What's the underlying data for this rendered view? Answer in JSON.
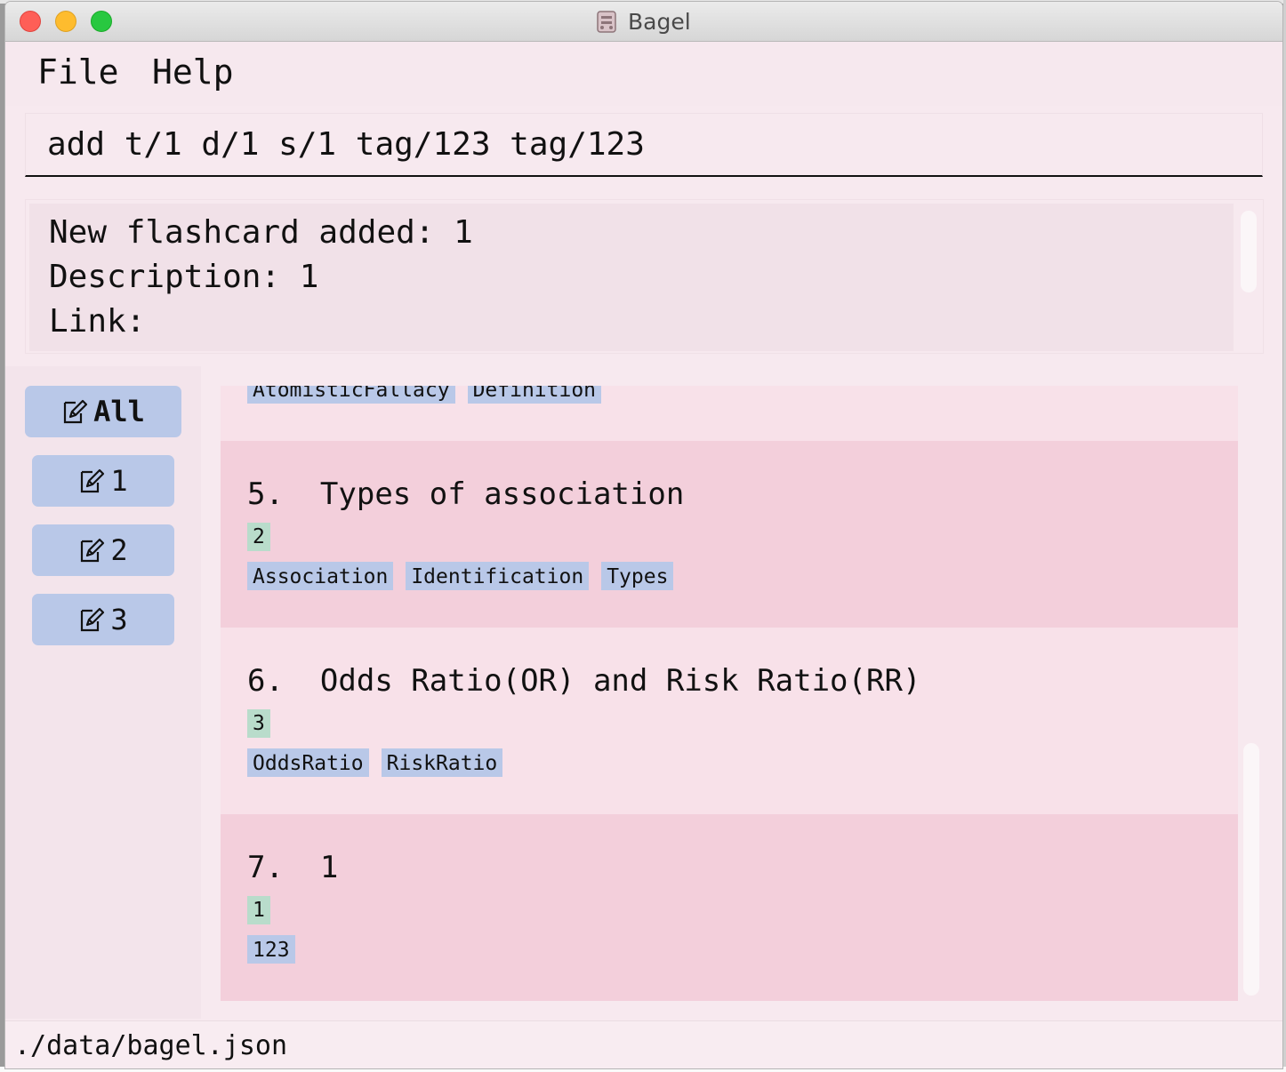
{
  "window": {
    "title": "Bagel"
  },
  "menu": {
    "file": "File",
    "help": "Help"
  },
  "command": {
    "value": "add t/1 d/1 s/1 tag/123 tag/123"
  },
  "result": {
    "line1": "New flashcard added: 1",
    "line2": "Description: 1",
    "line3": "Link:"
  },
  "sidebar": {
    "items": [
      {
        "label": "All",
        "selected": true
      },
      {
        "label": "1"
      },
      {
        "label": "2"
      },
      {
        "label": "3"
      }
    ]
  },
  "cards": [
    {
      "partial": true,
      "tags": [
        "AtomisticFallacy",
        "Definition"
      ]
    },
    {
      "index": "5.",
      "title": "Types of association",
      "set": "2",
      "tags": [
        "Association",
        "Identification",
        "Types"
      ]
    },
    {
      "index": "6.",
      "title": "Odds Ratio(OR) and Risk Ratio(RR)",
      "set": "3",
      "tags": [
        "OddsRatio",
        "RiskRatio"
      ]
    },
    {
      "index": "7.",
      "title": "1",
      "set": "1",
      "tags": [
        "123"
      ]
    }
  ],
  "status": {
    "path": "./data/bagel.json"
  },
  "colors": {
    "window_bg": "#f7e9ef",
    "card_odd": "#f8e1e9",
    "card_even": "#f3cfdb",
    "tag_bg": "#b9c8e8",
    "set_badge_bg": "#b9dccb"
  },
  "icons": {
    "folder_button": "edit-icon",
    "app": "bagel-icon"
  }
}
